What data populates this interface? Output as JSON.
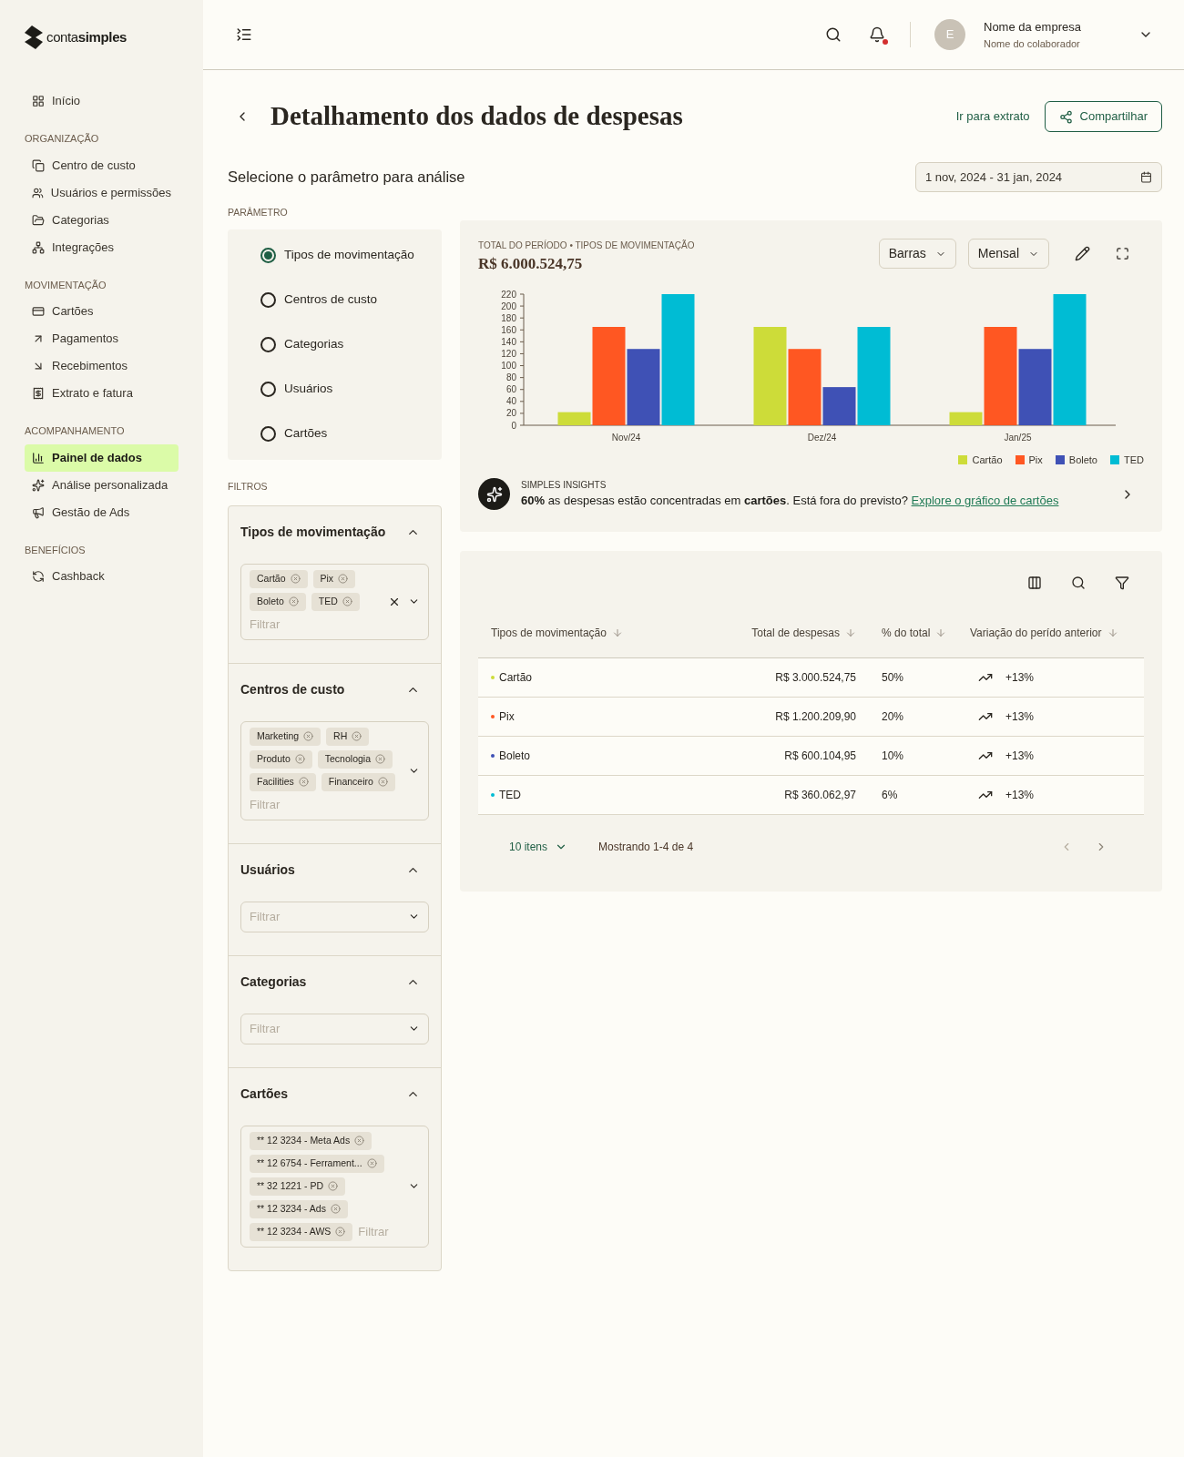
{
  "logo": {
    "text": "conta**simples**"
  },
  "sidebar": {
    "sections": [
      {
        "items": [
          {
            "label": "Início",
            "selected": false
          }
        ]
      },
      {
        "title": "ORGANIZAÇÃO",
        "items": [
          {
            "label": "Centro de custo",
            "selected": false
          },
          {
            "label": "Usuários e permissões",
            "selected": false
          },
          {
            "label": "Categorias",
            "selected": false
          },
          {
            "label": "Integrações",
            "selected": false
          }
        ]
      },
      {
        "title": "MOVIMENTAÇÃO",
        "items": [
          {
            "label": "Cartões",
            "selected": false
          },
          {
            "label": "Pagamentos",
            "selected": false
          },
          {
            "label": "Recebimentos",
            "selected": false
          },
          {
            "label": "Extrato e fatura",
            "selected": false
          }
        ]
      },
      {
        "title": "ACOMPANHAMENTO",
        "items": [
          {
            "label": "Painel de dados",
            "selected": true
          },
          {
            "label": "Análise personalizada",
            "selected": false
          },
          {
            "label": "Gestão de Ads",
            "selected": false
          }
        ]
      },
      {
        "title": "BENEFÍCIOS",
        "items": [
          {
            "label": "Cashback",
            "selected": false
          }
        ]
      }
    ]
  },
  "header": {
    "avatar": "E",
    "company": "Nome da empresa",
    "collaborator": "Nome do colaborador",
    "notification": true
  },
  "page": {
    "title": "Detalhamento dos dados de despesas",
    "link": "Ir para extrato",
    "share_button": "Compartilhar",
    "subtitle": "Selecione o parâmetro para análise",
    "date_range": "1 nov, 2024 - 31 jan, 2024"
  },
  "parameters": {
    "title": "PARÂMETRO",
    "options": [
      {
        "label": "Tipos de movimentação",
        "selected": true
      },
      {
        "label": "Centros de custo",
        "selected": false
      },
      {
        "label": "Categorias",
        "selected": false
      },
      {
        "label": "Usuários",
        "selected": false
      },
      {
        "label": "Cartões",
        "selected": false
      }
    ]
  },
  "filters": {
    "title": "FILTROS",
    "groups": [
      {
        "title": "Tipos de movimentação",
        "expanded": true,
        "clearable": true,
        "tags": [
          "Cartão",
          "Pix",
          "Boleto",
          "TED"
        ],
        "placeholder": "Filtrar"
      },
      {
        "title": "Centros de custo",
        "expanded": true,
        "clearable": false,
        "tags": [
          "Marketing",
          "RH",
          "Produto",
          "Tecnologia",
          "Facilities",
          "Financeiro"
        ],
        "placeholder": "Filtrar"
      },
      {
        "title": "Usuários",
        "expanded": true,
        "clearable": false,
        "placeholder": "Filtrar"
      },
      {
        "title": "Categorias",
        "expanded": true,
        "clearable": false,
        "placeholder": "Filtrar"
      },
      {
        "title": "Cartões",
        "expanded": true,
        "clearable": false,
        "tags": [
          "** 12 3234 - Meta Ads",
          "** 12 6754 - Ferrament...",
          "** 32 1221 - PD",
          "** 12 3234  - Ads",
          "** 12 3234  - AWS"
        ],
        "placeholder": "Filtrar"
      }
    ]
  },
  "chart_card": {
    "caption": "TOTAL DO PERÍODO • TIPOS DE MOVIMENTAÇÃO",
    "total": "R$ 6.000.524,75",
    "chart_type_select": "Barras",
    "period_select": "Mensal",
    "chart_data": {
      "type": "bar",
      "legend": true,
      "categories": [
        "Nov/24",
        "Dez/24",
        "Jan/25"
      ],
      "ylim": [
        0,
        220
      ],
      "yticks": [
        0,
        20,
        40,
        60,
        80,
        100,
        120,
        140,
        160,
        180,
        200,
        220
      ],
      "series": [
        {
          "name": "Cartão",
          "color": "#cddc39",
          "values": [
            22,
            165,
            22
          ]
        },
        {
          "name": "Pix",
          "color": "#ff5722",
          "values": [
            165,
            128,
            165
          ]
        },
        {
          "name": "Boleto",
          "color": "#3f51b5",
          "values": [
            128,
            64,
            128
          ]
        },
        {
          "name": "TED",
          "color": "#00bcd4",
          "values": [
            220,
            165,
            220
          ]
        }
      ]
    },
    "insight": {
      "label": "SIMPLES INSIGHTS",
      "text": "**60%** as despesas estão concentradas em **cartões**. Está fora do previsto?",
      "link": "Explore o gráfico de cartões"
    }
  },
  "table": {
    "columns": [
      "Tipos de movimentação",
      "Total de despesas",
      "% do total",
      "Variação do perído anterior"
    ],
    "rows": [
      {
        "name": "Cartão",
        "color": "#cddc39",
        "total": "R$ 3.000.524,75",
        "share": "50%",
        "variation": "+13%"
      },
      {
        "name": "Pix",
        "color": "#ff5722",
        "total": "R$ 1.200.209,90",
        "share": "20%",
        "variation": "+13%"
      },
      {
        "name": "Boleto",
        "color": "#3f51b5",
        "total": "R$ 600.104,95",
        "share": "10%",
        "variation": "+13%"
      },
      {
        "name": "TED",
        "color": "#00bcd4",
        "total": "R$ 360.062,97",
        "share": "6%",
        "variation": "+13%"
      }
    ],
    "page_size": "10 itens",
    "showing": "Mostrando 1-4 de 4"
  }
}
